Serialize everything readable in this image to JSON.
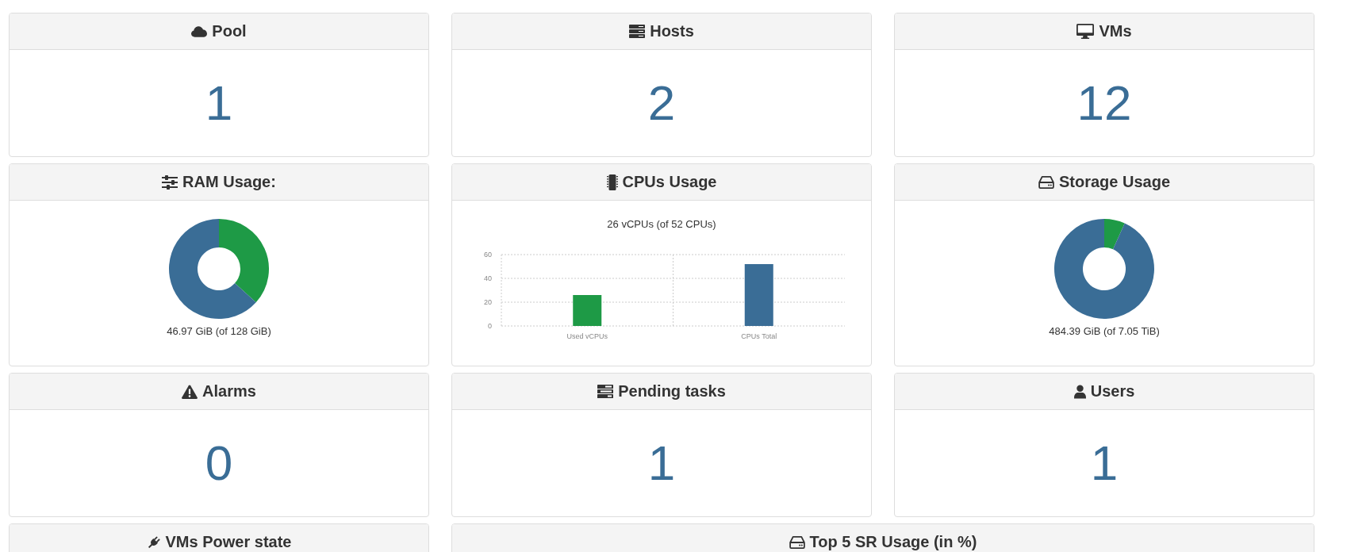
{
  "rows": [
    [
      {
        "kind": "count",
        "title": "Pool",
        "value": "1"
      },
      {
        "kind": "count",
        "title": "Hosts",
        "value": "2"
      },
      {
        "kind": "count",
        "title": "VMs",
        "value": "12"
      }
    ],
    [
      {
        "kind": "chart",
        "title": "RAM Usage:",
        "caption": "46.97 GiB (of 128 GiB)",
        "chart_data": {
          "type": "donut",
          "values": [
            36.7,
            63.3
          ]
        }
      },
      {
        "kind": "chart",
        "title": "CPUs Usage",
        "chart_data": {
          "type": "bar",
          "title": "26 vCPUs (of 52 CPUs)",
          "categories": [
            "Used vCPUs",
            "CPUs Total"
          ],
          "values": [
            26,
            52
          ],
          "ylim": [
            0,
            60
          ],
          "yticks": [
            0,
            20,
            40,
            60
          ]
        }
      },
      {
        "kind": "chart",
        "title": "Storage Usage",
        "caption": "484.39 GiB (of 7.05 TiB)",
        "chart_data": {
          "type": "donut",
          "values": [
            6.71,
            93.29
          ]
        }
      }
    ],
    [
      {
        "kind": "count",
        "title": "Alarms",
        "value": "0"
      },
      {
        "kind": "count",
        "title": "Pending tasks",
        "value": "1"
      },
      {
        "kind": "count",
        "title": "Users",
        "value": "1"
      }
    ],
    [
      {
        "kind": "heading",
        "title": "VMs Power state"
      },
      {
        "kind": "heading",
        "title": "Top 5 SR Usage (in %)"
      }
    ]
  ]
}
